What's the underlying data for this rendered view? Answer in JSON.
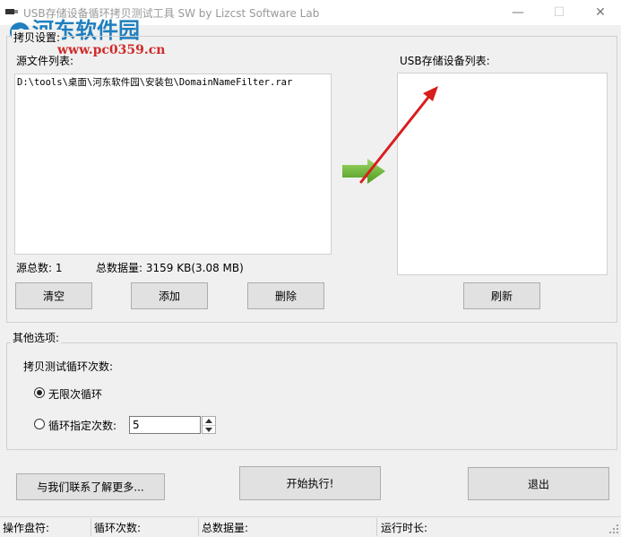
{
  "window": {
    "title": "USB存储设备循环拷贝测试工具 SW   by Lizcst Software Lab",
    "minimize_glyph": "—",
    "maximize_glyph": "☐",
    "close_glyph": "✕"
  },
  "watermark": {
    "site_name": "河东软件园",
    "site_url": "www.pc0359.cn"
  },
  "copy_settings": {
    "group_label": "拷贝设置:",
    "source_list_label": "源文件列表:",
    "source_files": [
      "D:\\tools\\桌面\\河东软件园\\安装包\\DomainNameFilter.rar"
    ],
    "source_count_label": "源总数: 1",
    "total_size_label": "总数据量: 3159 KB(3.08 MB)",
    "clear_button": "清空",
    "add_button": "添加",
    "delete_button": "删除",
    "usb_list_label": "USB存储设备列表:",
    "refresh_button": "刷新"
  },
  "other_options": {
    "group_label": "其他选项:",
    "loop_count_label": "拷贝测试循环次数:",
    "unlimited_label": "无限次循环",
    "unlimited_selected": true,
    "specified_label": "循环指定次数:",
    "specified_selected": false,
    "specified_value": "5"
  },
  "actions": {
    "contact_button": "与我们联系了解更多...",
    "start_button": "开始执行!",
    "exit_button": "退出"
  },
  "statusbar": {
    "operation_disk": "操作盘符:",
    "loop_count": "循环次数:",
    "total_data": "总数据量:",
    "run_time": "运行时长:"
  },
  "colors": {
    "arrow_green": "#6dbb2f",
    "annotation_red": "#d81e1e",
    "watermark_blue": "#1f7fbf",
    "watermark_red": "#d12b2b"
  }
}
